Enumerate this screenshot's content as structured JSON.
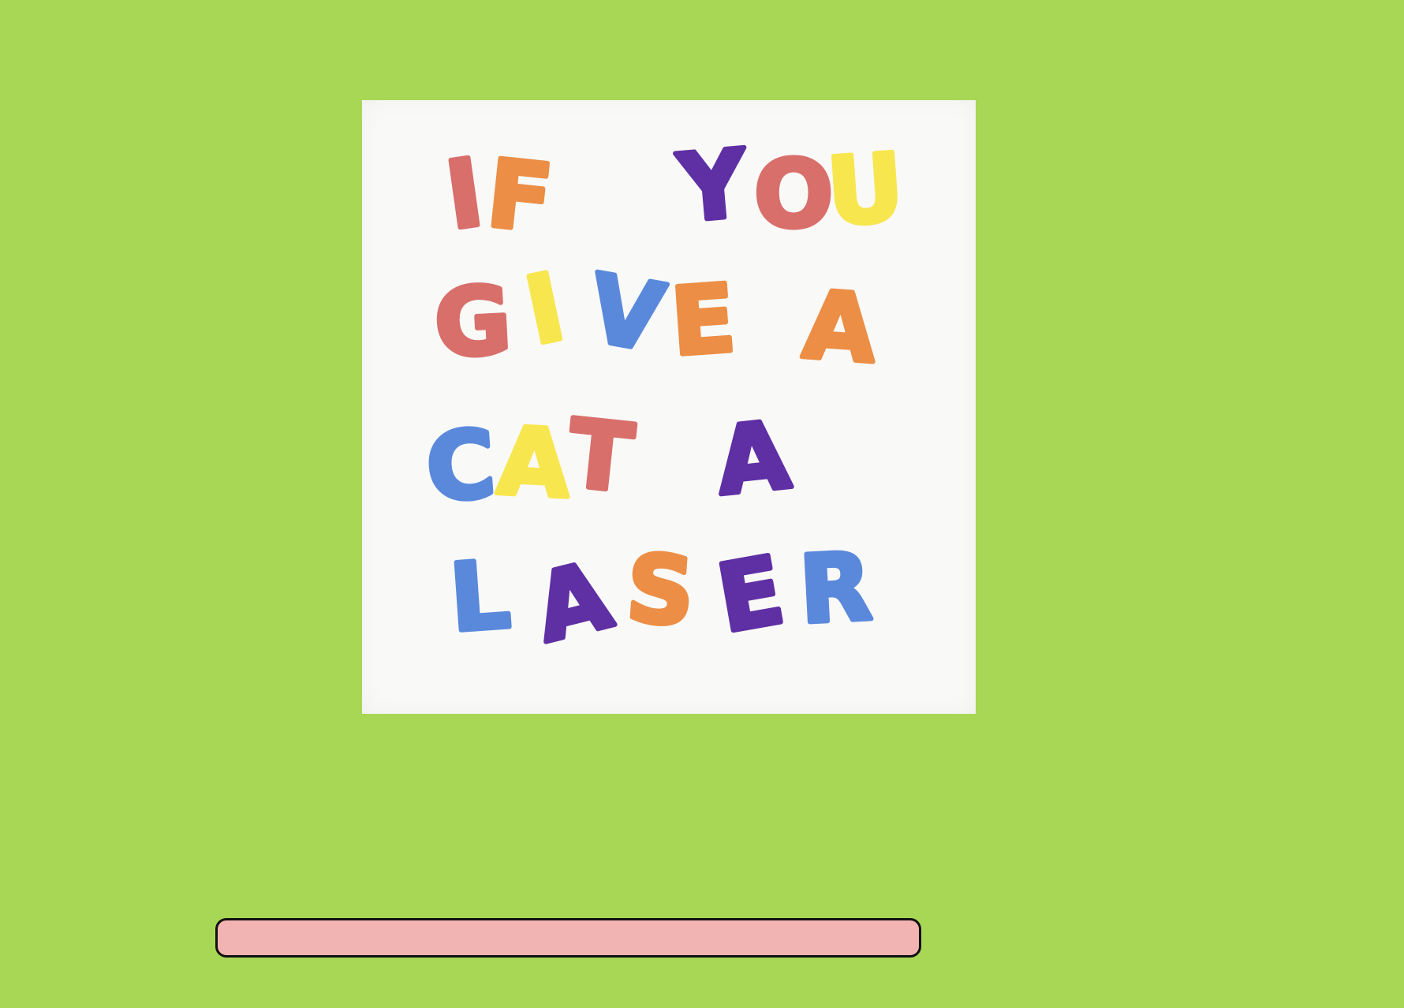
{
  "cover": {
    "lines": [
      {
        "letters": [
          {
            "ch": "I",
            "color": "#d86f6b"
          },
          {
            "ch": "F",
            "color": "#ec8e45"
          },
          {
            "ch": "Y",
            "color": "#5f2fa4"
          },
          {
            "ch": "O",
            "color": "#d86f6b"
          },
          {
            "ch": "U",
            "color": "#f8e64f"
          }
        ]
      },
      {
        "letters": [
          {
            "ch": "G",
            "color": "#d86f6b"
          },
          {
            "ch": "I",
            "color": "#f8e64f"
          },
          {
            "ch": "V",
            "color": "#5a89dc"
          },
          {
            "ch": "E",
            "color": "#ec8e45"
          },
          {
            "ch": "A",
            "color": "#ec8e45"
          }
        ]
      },
      {
        "letters": [
          {
            "ch": "C",
            "color": "#5a89dc"
          },
          {
            "ch": "A",
            "color": "#f8e64f"
          },
          {
            "ch": "T",
            "color": "#d86f6b"
          },
          {
            "ch": "A",
            "color": "#5f2fa4"
          }
        ]
      },
      {
        "letters": [
          {
            "ch": "L",
            "color": "#5a89dc"
          },
          {
            "ch": "A",
            "color": "#5f2fa4"
          },
          {
            "ch": "S",
            "color": "#ec8e45"
          },
          {
            "ch": "E",
            "color": "#5f2fa4"
          },
          {
            "ch": "R",
            "color": "#5a89dc"
          }
        ]
      }
    ]
  },
  "colors": {
    "background": "#a8d655",
    "cover_paper": "#f9f9f8",
    "bar_fill": "#f2b4b3",
    "bar_border": "#111111"
  }
}
